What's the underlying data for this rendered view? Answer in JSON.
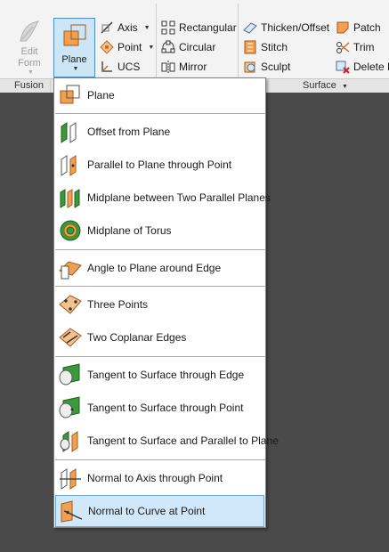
{
  "ribbon": {
    "panels": {
      "fusion": "Fusion",
      "surface": "Surface"
    },
    "edit_form": {
      "line1": "Edit",
      "line2": "Form"
    },
    "plane_button": {
      "label": "Plane"
    },
    "work_features": [
      {
        "label": "Axis",
        "icon": "axis-icon",
        "has_menu": true
      },
      {
        "label": "Point",
        "icon": "point-icon",
        "has_menu": true
      },
      {
        "label": "UCS",
        "icon": "ucs-icon",
        "has_menu": false
      }
    ],
    "pattern": [
      {
        "label": "Rectangular",
        "icon": "rectangular-pattern-icon"
      },
      {
        "label": "Circular",
        "icon": "circular-pattern-icon"
      },
      {
        "label": "Mirror",
        "icon": "mirror-icon"
      }
    ],
    "surface_col1": [
      {
        "label": "Thicken/Offset",
        "icon": "thicken-offset-icon"
      },
      {
        "label": "Stitch",
        "icon": "stitch-icon"
      },
      {
        "label": "Sculpt",
        "icon": "sculpt-icon"
      }
    ],
    "surface_col2": [
      {
        "label": "Patch",
        "icon": "patch-icon"
      },
      {
        "label": "Trim",
        "icon": "trim-icon"
      },
      {
        "label": "Delete F",
        "icon": "delete-face-icon"
      }
    ]
  },
  "plane_menu": {
    "groups": [
      [
        {
          "label": "Plane",
          "icon": "plane-icon"
        }
      ],
      [
        {
          "label": "Offset from Plane",
          "icon": "offset-plane-icon"
        },
        {
          "label": "Parallel to Plane through Point",
          "icon": "parallel-plane-point-icon"
        },
        {
          "label": "Midplane between Two Parallel Planes",
          "icon": "midplane-icon"
        },
        {
          "label": "Midplane of Torus",
          "icon": "midplane-torus-icon"
        }
      ],
      [
        {
          "label": "Angle to Plane around Edge",
          "icon": "angle-plane-edge-icon"
        }
      ],
      [
        {
          "label": "Three Points",
          "icon": "three-points-icon"
        },
        {
          "label": "Two Coplanar Edges",
          "icon": "two-coplanar-edges-icon"
        }
      ],
      [
        {
          "label": "Tangent to Surface through Edge",
          "icon": "tangent-surface-edge-icon"
        },
        {
          "label": "Tangent to Surface through Point",
          "icon": "tangent-surface-point-icon"
        },
        {
          "label": "Tangent to Surface and Parallel to Plane",
          "icon": "tangent-surface-parallel-icon"
        }
      ],
      [
        {
          "label": "Normal to Axis through Point",
          "icon": "normal-axis-point-icon"
        },
        {
          "label": "Normal to Curve at Point",
          "icon": "normal-curve-point-icon",
          "active": true
        }
      ]
    ]
  },
  "colors": {
    "accent_orange": "#f0a050",
    "accent_green": "#3a9a3a",
    "highlight": "#d1e8fa"
  }
}
